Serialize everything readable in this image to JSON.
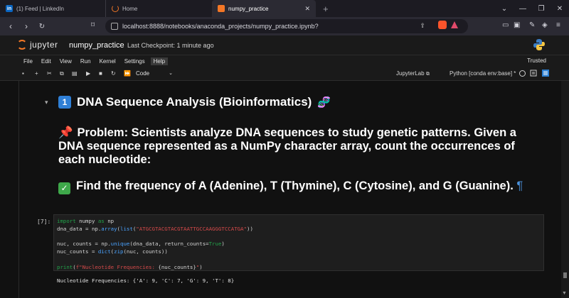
{
  "browser": {
    "tabs": [
      {
        "title": "(1) Feed | LinkedIn",
        "favicon": "in"
      },
      {
        "title": "Home"
      },
      {
        "title": "numpy_practice",
        "active": true
      }
    ],
    "new_tab": "+",
    "url": "localhost:8888/notebooks/anaconda_projects/numpy_practice.ipynb?"
  },
  "jupyter": {
    "logo_text": "jupyter",
    "notebook_name": "numpy_practice",
    "checkpoint": "Last Checkpoint: 1 minute ago",
    "menu": [
      "File",
      "Edit",
      "View",
      "Run",
      "Kernel",
      "Settings",
      "Help"
    ],
    "trusted": "Trusted",
    "cell_type": "Code",
    "jupyterlab_label": "JupyterLab",
    "kernel": "Python [conda env:base] *"
  },
  "notebook": {
    "heading_badge": "1",
    "heading": "DNA Sequence Analysis (Bioinformatics)",
    "problem": "Problem: Scientists analyze DNA sequences to study genetic patterns. Given a DNA sequence represented as a NumPy character array, count the occurrences of each nucleotide:",
    "find": "Find the frequency of A (Adenine), T (Thymine), C (Cytosine), and G (Guanine).",
    "pilcrow": "¶",
    "prompt": "[7]:",
    "code": {
      "l1_kw1": "import",
      "l1_mod": " numpy ",
      "l1_kw2": "as",
      "l1_alias": " np",
      "l2_a": "dna_data = np.",
      "l2_fn1": "array",
      "l2_b": "(",
      "l2_fn2": "list",
      "l2_c": "(",
      "l2_str": "\"ATGCGTACGTACGTAATTGCCAAGGGTCCATGA\"",
      "l2_d": "))",
      "l4_a": "nuc, counts = np.",
      "l4_fn": "unique",
      "l4_b": "(dna_data, return_counts=",
      "l4_bool": "True",
      "l4_c": ")",
      "l5_a": "nuc_counts = ",
      "l5_fn1": "dict",
      "l5_b": "(",
      "l5_fn2": "zip",
      "l5_c": "(nuc, counts))",
      "l7_fn": "print",
      "l7_a": "(",
      "l7_str1": "f\"Nucleotide Frequencies: ",
      "l7_var": "{nuc_counts}",
      "l7_str2": "\"",
      "l7_b": ")"
    },
    "output": "Nucleotide Frequencies: {'A': 9, 'C': 7, 'G': 9, 'T': 8}"
  }
}
